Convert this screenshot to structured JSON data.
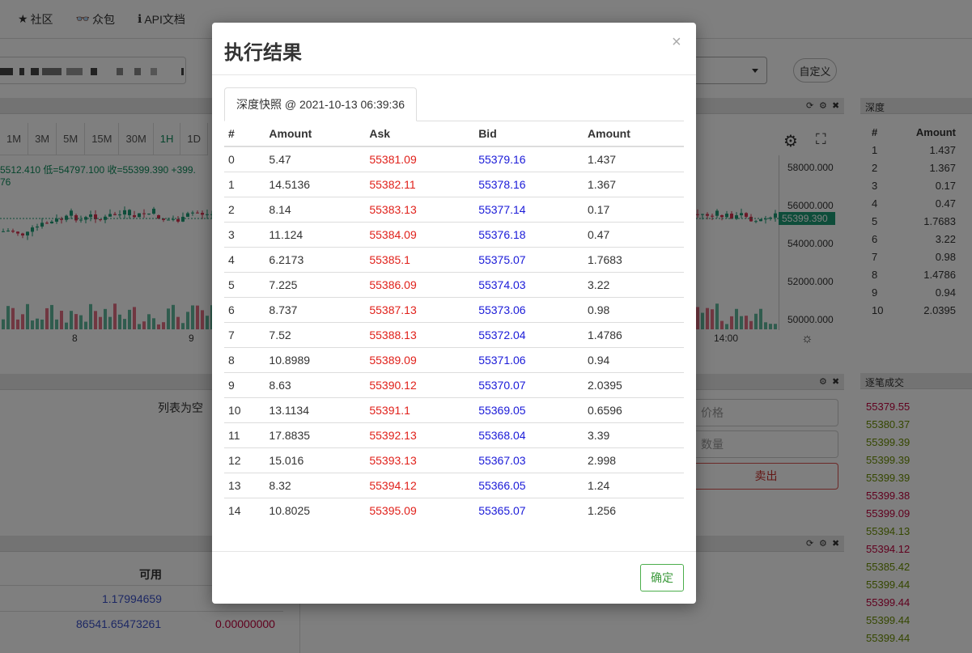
{
  "nav": {
    "items": [
      {
        "icon": "star-icon",
        "glyph": "★",
        "label": "社区"
      },
      {
        "icon": "glasses-icon",
        "glyph": "👓",
        "label": "众包"
      },
      {
        "icon": "info-icon",
        "glyph": "ℹ",
        "label": "API文档"
      }
    ]
  },
  "toolbar": {
    "custom_label": "自定义"
  },
  "timeframes": [
    "1M",
    "3M",
    "5M",
    "15M",
    "30M",
    "1H",
    "1D"
  ],
  "active_timeframe": "1H",
  "chart": {
    "ohlc_text": "5512.410 低=54797.100 收=55399.390 +399.",
    "ohlc_sub": "76",
    "y_ticks": [
      "58000.000",
      "56000.000",
      "54000.000",
      "52000.000",
      "50000.000"
    ],
    "last_price": "55399.390",
    "x_ticks": [
      "8",
      "9",
      "14:00"
    ]
  },
  "depth_panel": {
    "title": "深度",
    "col_index": "#",
    "col_amount": "Amount",
    "rows": [
      {
        "i": "1",
        "a": "1.437"
      },
      {
        "i": "2",
        "a": "1.367"
      },
      {
        "i": "3",
        "a": "0.17"
      },
      {
        "i": "4",
        "a": "0.47"
      },
      {
        "i": "5",
        "a": "1.7683"
      },
      {
        "i": "6",
        "a": "3.22"
      },
      {
        "i": "7",
        "a": "0.98"
      },
      {
        "i": "8",
        "a": "1.4786"
      },
      {
        "i": "9",
        "a": "0.94"
      },
      {
        "i": "10",
        "a": "2.0395"
      }
    ]
  },
  "trades_panel": {
    "title": "逐笔成交",
    "items": [
      {
        "price": "55379.55",
        "side": "sell"
      },
      {
        "price": "55380.37",
        "side": "buy"
      },
      {
        "price": "55399.39",
        "side": "buy"
      },
      {
        "price": "55399.39",
        "side": "buy"
      },
      {
        "price": "55399.39",
        "side": "buy"
      },
      {
        "price": "55399.38",
        "side": "sell"
      },
      {
        "price": "55399.09",
        "side": "sell"
      },
      {
        "price": "55394.13",
        "side": "buy"
      },
      {
        "price": "55394.12",
        "side": "sell"
      },
      {
        "price": "55385.42",
        "side": "buy"
      },
      {
        "price": "55399.44",
        "side": "buy"
      },
      {
        "price": "55399.44",
        "side": "sell"
      },
      {
        "price": "55399.44",
        "side": "buy"
      },
      {
        "price": "55399.44",
        "side": "buy"
      }
    ]
  },
  "orders": {
    "empty_text": "列表为空"
  },
  "trade_form": {
    "price_placeholder": "价格",
    "amount_placeholder": "数量",
    "sell_label": "卖出"
  },
  "assets": {
    "avail_header": "可用",
    "val1": "1.17994659",
    "val2": "86541.65473261",
    "val3": "0.00000000"
  },
  "modal": {
    "title": "执行结果",
    "close_glyph": "×",
    "tab_label": "深度快照 @ 2021-10-13 06:39:36",
    "columns": [
      "#",
      "Amount",
      "Ask",
      "Bid",
      "Amount"
    ],
    "rows": [
      [
        "0",
        "5.47",
        "55381.09",
        "55379.16",
        "1.437"
      ],
      [
        "1",
        "14.5136",
        "55382.11",
        "55378.16",
        "1.367"
      ],
      [
        "2",
        "8.14",
        "55383.13",
        "55377.14",
        "0.17"
      ],
      [
        "3",
        "11.124",
        "55384.09",
        "55376.18",
        "0.47"
      ],
      [
        "4",
        "6.2173",
        "55385.1",
        "55375.07",
        "1.7683"
      ],
      [
        "5",
        "7.225",
        "55386.09",
        "55374.03",
        "3.22"
      ],
      [
        "6",
        "8.737",
        "55387.13",
        "55373.06",
        "0.98"
      ],
      [
        "7",
        "7.52",
        "55388.13",
        "55372.04",
        "1.4786"
      ],
      [
        "8",
        "10.8989",
        "55389.09",
        "55371.06",
        "0.94"
      ],
      [
        "9",
        "8.63",
        "55390.12",
        "55370.07",
        "2.0395"
      ],
      [
        "10",
        "13.1134",
        "55391.1",
        "55369.05",
        "0.6596"
      ],
      [
        "11",
        "17.8835",
        "55392.13",
        "55368.04",
        "3.39"
      ],
      [
        "12",
        "15.016",
        "55393.13",
        "55367.03",
        "2.998"
      ],
      [
        "13",
        "8.32",
        "55394.12",
        "55366.05",
        "1.24"
      ],
      [
        "14",
        "10.8025",
        "55395.09",
        "55365.07",
        "1.256"
      ]
    ],
    "ok_label": "确定"
  },
  "colors": {
    "ask": "#e0201a",
    "bid": "#1a1ad8",
    "up": "#1d9a74",
    "down": "#d6304e",
    "buy_text": "#6b8e00",
    "sell_text": "#c0003c"
  }
}
